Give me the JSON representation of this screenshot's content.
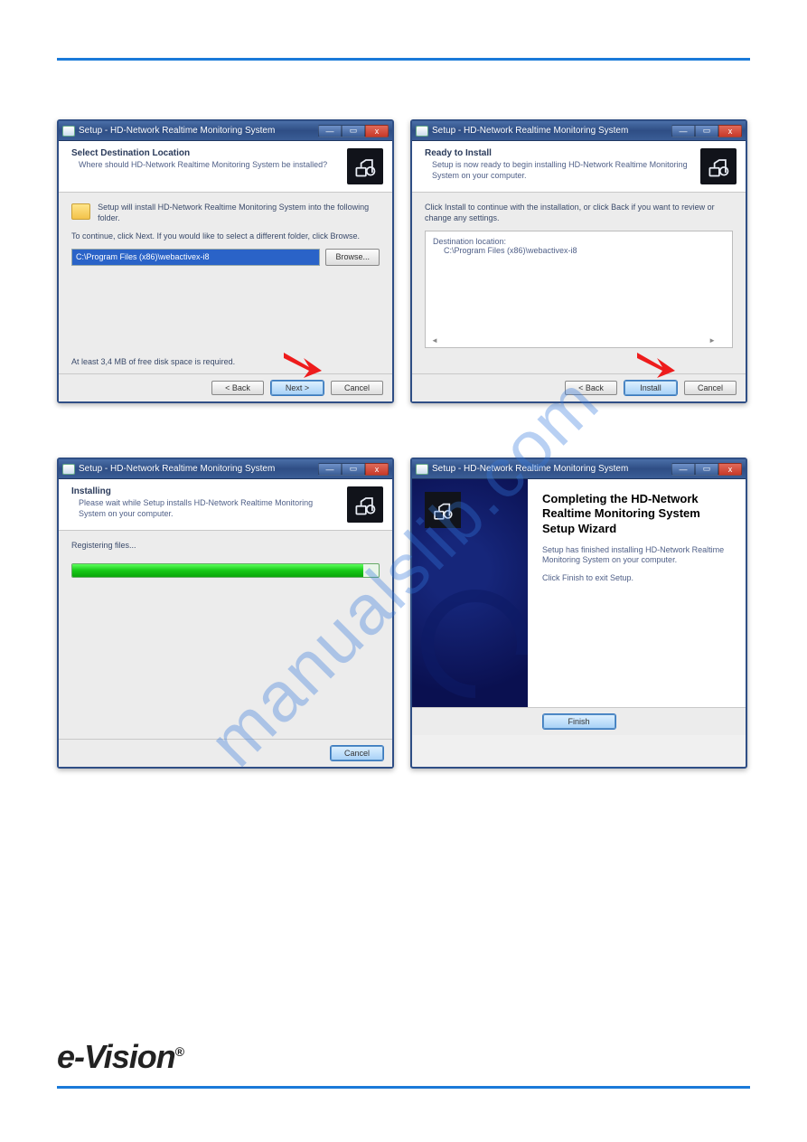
{
  "brand": "e-Vision",
  "watermark": "manualslib.com",
  "dialogs": {
    "d1": {
      "title": "Setup - HD-Network Realtime Monitoring System",
      "header_title": "Select Destination Location",
      "header_sub": "Where should HD-Network Realtime Monitoring System be installed?",
      "folder_text": "Setup will install HD-Network Realtime Monitoring System into the following folder.",
      "continue_text": "To continue, click Next. If you would like to select a different folder, click Browse.",
      "path": "C:\\Program Files (x86)\\webactivex-i8",
      "browse": "Browse...",
      "disk_note": "At least 3,4 MB of free disk space is required.",
      "back": "< Back",
      "next": "Next >",
      "cancel": "Cancel"
    },
    "d2": {
      "title": "Setup - HD-Network Realtime Monitoring System",
      "header_title": "Ready to Install",
      "header_sub": "Setup is now ready to begin installing HD-Network Realtime Monitoring System on your computer.",
      "instruct": "Click Install to continue with the installation, or click Back if you want to review or change any settings.",
      "dest_label": "Destination location:",
      "dest_value": "C:\\Program Files (x86)\\webactivex-i8",
      "back": "< Back",
      "install": "Install",
      "cancel": "Cancel"
    },
    "d3": {
      "title": "Setup - HD-Network Realtime Monitoring System",
      "header_title": "Installing",
      "header_sub": "Please wait while Setup installs HD-Network Realtime Monitoring System on your computer.",
      "status": "Registering files...",
      "cancel": "Cancel"
    },
    "d4": {
      "title": "Setup - HD-Network Realtime Monitoring System",
      "heading": "Completing the HD-Network Realtime Monitoring System Setup Wizard",
      "line1": "Setup has finished installing HD-Network Realtime Monitoring System on your computer.",
      "line2": "Click Finish to exit Setup.",
      "finish": "Finish"
    }
  }
}
